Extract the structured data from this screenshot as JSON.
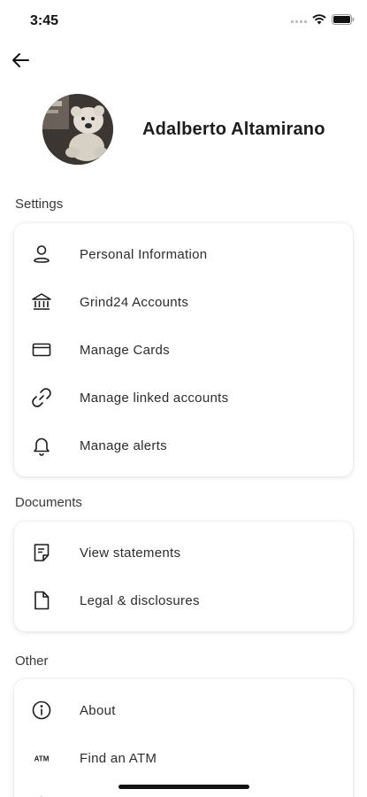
{
  "status_bar": {
    "time": "3:45"
  },
  "profile": {
    "name": "Adalberto Altamirano"
  },
  "sections": {
    "settings": {
      "title": "Settings",
      "items": [
        {
          "label": "Personal Information",
          "icon": "person-icon"
        },
        {
          "label": "Grind24 Accounts",
          "icon": "bank-icon"
        },
        {
          "label": "Manage Cards",
          "icon": "card-icon"
        },
        {
          "label": "Manage linked accounts",
          "icon": "link-icon"
        },
        {
          "label": "Manage alerts",
          "icon": "bell-icon"
        }
      ]
    },
    "documents": {
      "title": "Documents",
      "items": [
        {
          "label": "View statements",
          "icon": "statement-icon"
        },
        {
          "label": "Legal & disclosures",
          "icon": "document-icon"
        }
      ]
    },
    "other": {
      "title": "Other",
      "items": [
        {
          "label": "About",
          "icon": "info-icon"
        },
        {
          "label": "Find an ATM",
          "icon": "atm-icon"
        }
      ]
    }
  },
  "atm_icon_text": "ATM"
}
